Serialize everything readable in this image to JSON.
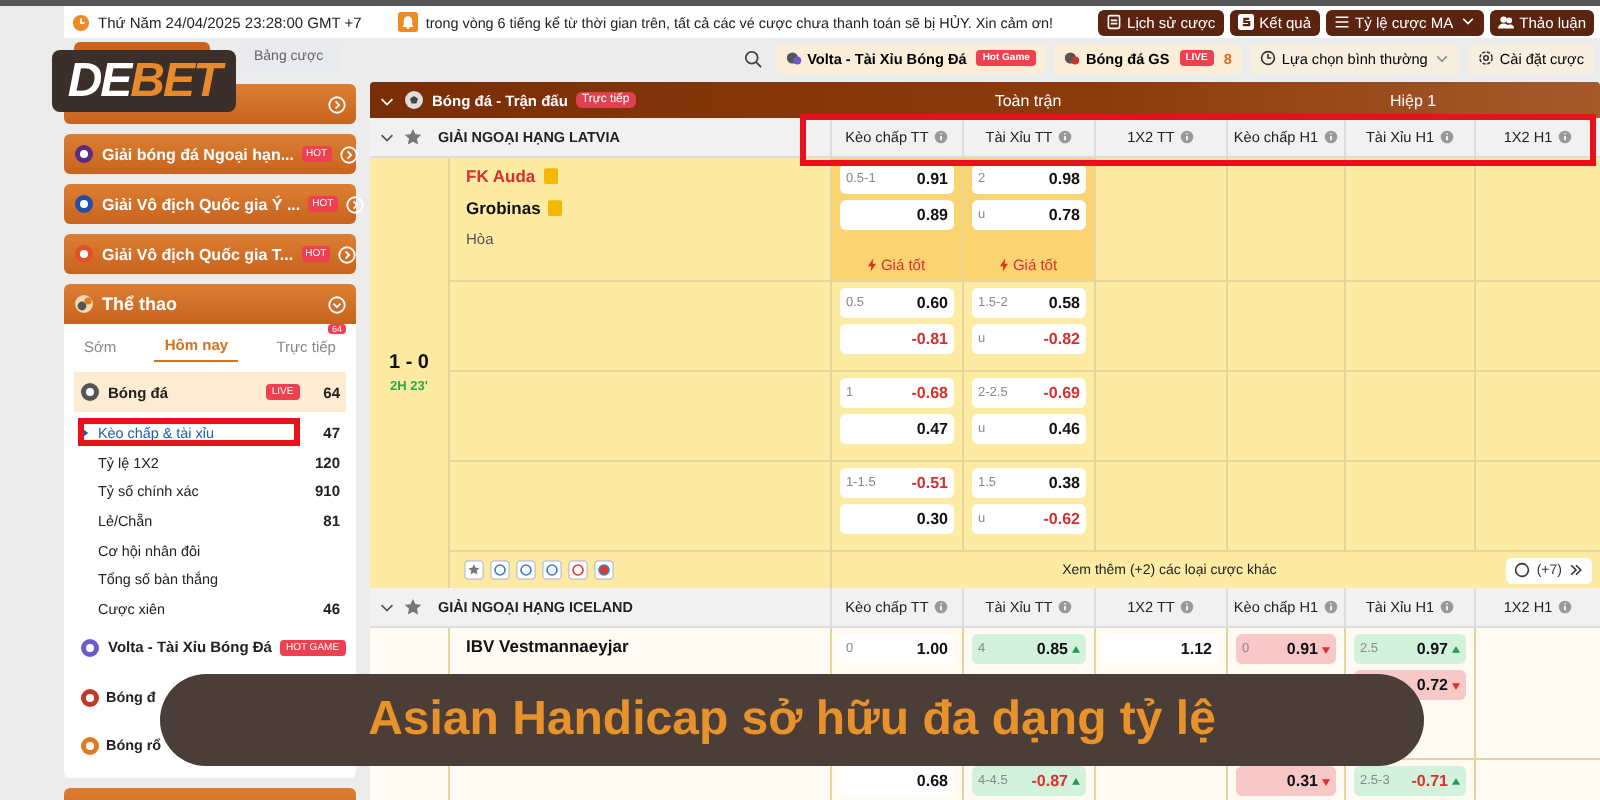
{
  "topbar": {
    "datetime": "Thứ Năm 24/04/2025 23:28:00 GMT +7",
    "notice": "trong vòng 6 tiếng kể từ thời gian trên, tất cả các vé cược chưa thanh toán sẽ bị HỦY. Xin cảm ơn!",
    "buttons": [
      {
        "kind": "history",
        "label": "Lịch sử cược"
      },
      {
        "kind": "results",
        "label": "Kết quả"
      },
      {
        "kind": "odds",
        "label": "Tỷ lệ cược MA"
      },
      {
        "kind": "chat",
        "label": "Thảo luận"
      }
    ]
  },
  "logo": {
    "lead": "DE",
    "rest": "BET"
  },
  "sidebar": {
    "tab": "Bảng cược",
    "leagues": [
      {
        "kind": "premier",
        "name": "Giải bóng đá Ngoại hạn...",
        "badge": "HOT"
      },
      {
        "kind": "seriea",
        "name": "Giải Vô địch Quốc gia Ý ...",
        "badge": "HOT"
      },
      {
        "kind": "generic",
        "name": "Giải Vô địch Quốc gia T...",
        "badge": "HOT"
      }
    ],
    "sports": {
      "title": "Thể thao",
      "tabs": [
        {
          "label": "Sớm",
          "selected": false
        },
        {
          "label": "Hôm nay",
          "selected": true
        },
        {
          "label": "Trực tiếp",
          "selected": false,
          "count": "64"
        }
      ],
      "items": [
        {
          "kind": "football",
          "name": "Bóng đá",
          "badge": "LIVE",
          "count": "64",
          "children": [
            {
              "name": "Kèo chấp & tài xỉu",
              "count": "47",
              "selected": true
            },
            {
              "name": "Tỷ lệ 1X2",
              "count": "120",
              "selected": false
            },
            {
              "name": "Tỷ số chính xác",
              "count": "910",
              "selected": false
            },
            {
              "name": "Lẻ/Chẵn",
              "count": "81",
              "selected": false
            },
            {
              "name": "Cơ hội nhân đôi",
              "selected": false
            },
            {
              "name": "Tổng số bàn thắng",
              "selected": false
            },
            {
              "name": "Cược xiên",
              "count": "46",
              "selected": false
            }
          ]
        },
        {
          "kind": "volta",
          "name": "Volta - Tài Xỉu Bóng Đá",
          "badge": "HOT GAME"
        },
        {
          "kind": "gs",
          "name": "Bóng đ"
        },
        {
          "kind": "basketball",
          "name": "Bóng rổ"
        }
      ]
    }
  },
  "filters": [
    {
      "kind": "volta",
      "label": "Volta - Tài Xỉu Bóng Đá",
      "badge": "Hot Game"
    },
    {
      "kind": "gs",
      "label": "Bóng đá GS",
      "badge": "LIVE",
      "count": "8"
    },
    {
      "kind": "select",
      "label": "Lựa chọn bình thường"
    },
    {
      "kind": "settings",
      "label": "Cài đặt cược"
    }
  ],
  "board": {
    "title": "Bóng đá - Trận đấu",
    "badge": "Trực tiếp",
    "full": "Toàn trận",
    "half": "Hiệp 1",
    "leagues": [
      {
        "name": "GIẢI NGOẠI HẠNG LATVIA",
        "columns": [
          "Kèo chấp TT",
          "Tài Xỉu TT",
          "1X2 TT",
          "Kèo chấp H1",
          "Tài Xỉu H1",
          "1X2 H1"
        ],
        "match": {
          "live": true,
          "score": "1 - 0",
          "clock": "2H 23'",
          "teams": [
            {
              "name": "FK Auda",
              "favorite": true
            },
            {
              "name": "Grobinas",
              "favorite": false
            }
          ],
          "draw": "Hòa",
          "rows": [
            {
              "cells": [
                {
                  "top": {
                    "line": "0.5-1",
                    "price": "0.91"
                  },
                  "bottom": {
                    "price": "0.89"
                  },
                  "best": "Giá tốt"
                },
                {
                  "top": {
                    "line": "2",
                    "price": "0.98"
                  },
                  "bottom": {
                    "line": "u",
                    "price": "0.78"
                  },
                  "best": "Giá tốt"
                },
                {},
                {},
                {},
                {}
              ]
            },
            {
              "cells": [
                {
                  "top": {
                    "line": "0.5",
                    "price": "0.60"
                  },
                  "bottom": {
                    "price": "-0.81",
                    "negative": true
                  }
                },
                {
                  "top": {
                    "line": "1.5-2",
                    "price": "0.58"
                  },
                  "bottom": {
                    "line": "u",
                    "price": "-0.82",
                    "negative": true
                  }
                },
                {},
                {},
                {},
                {}
              ]
            },
            {
              "cells": [
                {
                  "top": {
                    "line": "1",
                    "price": "-0.68",
                    "negative": true
                  },
                  "bottom": {
                    "price": "0.47"
                  }
                },
                {
                  "top": {
                    "line": "2-2.5",
                    "price": "-0.69",
                    "negative": true
                  },
                  "bottom": {
                    "line": "u",
                    "price": "0.46"
                  }
                },
                {},
                {},
                {},
                {}
              ]
            },
            {
              "cells": [
                {
                  "top": {
                    "line": "1-1.5",
                    "price": "-0.51",
                    "negative": true
                  },
                  "bottom": {
                    "price": "0.30"
                  }
                },
                {
                  "top": {
                    "line": "1.5",
                    "price": "0.38"
                  },
                  "bottom": {
                    "line": "u",
                    "price": "-0.62",
                    "negative": true
                  }
                },
                {},
                {},
                {},
                {}
              ]
            }
          ],
          "more": "Xem thêm (+2) các loại cược khác",
          "extra": "(+7)"
        }
      },
      {
        "name": "GIẢI NGOẠI HẠNG ICELAND",
        "columns": [
          "Kèo chấp TT",
          "Tài Xỉu TT",
          "1X2 TT",
          "Kèo chấp H1",
          "Tài Xỉu H1",
          "1X2 H1"
        ],
        "match": {
          "live": false,
          "teams": [
            {
              "name": "IBV Vestmannaeyjar",
              "favorite": false
            }
          ],
          "rows": [
            {
              "cells": [
                {
                  "top": {
                    "line": "0",
                    "price": "1.00"
                  }
                },
                {
                  "top": {
                    "line": "4",
                    "price": "0.85",
                    "up": true
                  }
                },
                {
                  "top": {
                    "price": "1.12"
                  }
                },
                {
                  "top": {
                    "line": "0",
                    "price": "0.91",
                    "up": false
                  }
                },
                {
                  "top": {
                    "line": "2.5",
                    "price": "0.97",
                    "up": true
                  },
                  "bottom": {
                    "price": "0.72",
                    "up": false
                  }
                },
                {}
              ]
            },
            {
              "cells": [
                {
                  "top": {
                    "price": "0.68"
                  }
                },
                {
                  "top": {
                    "line": "4-4.5",
                    "price": "-0.87",
                    "negative": true,
                    "up": true
                  }
                },
                {},
                {
                  "top": {
                    "price": "0.31",
                    "up": false
                  }
                },
                {
                  "top": {
                    "line": "2.5-3",
                    "price": "-0.71",
                    "negative": true,
                    "up": true
                  }
                },
                {}
              ]
            }
          ]
        }
      }
    ]
  },
  "caption": "Asian Handicap sở hữu đa dạng tỷ lệ"
}
